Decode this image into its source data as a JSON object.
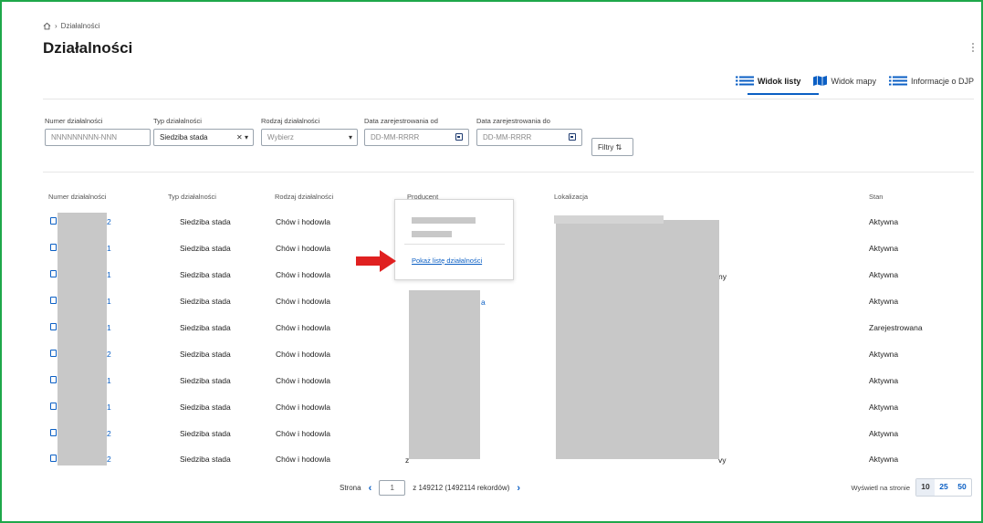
{
  "breadcrumb": {
    "home_icon": "home-icon",
    "current": "Działalności"
  },
  "page": {
    "title": "Działalności"
  },
  "views": [
    {
      "label": "Widok listy",
      "icon": "list-icon",
      "active": true
    },
    {
      "label": "Widok mapy",
      "icon": "map-icon",
      "active": false
    },
    {
      "label": "Informacje o DJP",
      "icon": "list-icon",
      "active": false
    }
  ],
  "filters": {
    "numer": {
      "label": "Numer działalności",
      "placeholder": "NNNNNNNNN-NNN"
    },
    "typ": {
      "label": "Typ działalności",
      "value": "Siedziba stada"
    },
    "rodzaj": {
      "label": "Rodzaj działalności",
      "placeholder": "Wybierz"
    },
    "data_od": {
      "label": "Data zarejestrowania od",
      "placeholder": "DD-MM-RRRR"
    },
    "data_do": {
      "label": "Data zarejestrowania do",
      "placeholder": "DD-MM-RRRR"
    },
    "more_button": "Filtry ⇅"
  },
  "table": {
    "columns": [
      "Numer działalności",
      "Typ działalności",
      "Rodzaj działalności",
      "Producent",
      "Lokalizacja",
      "Stan"
    ],
    "rows": [
      {
        "numer_suffix": "2",
        "typ": "Siedziba stada",
        "rodzaj": "Chów i hodowla",
        "stan": "Aktywna"
      },
      {
        "numer_suffix": "1",
        "typ": "Siedziba stada",
        "rodzaj": "Chów i hodowla",
        "stan": "Aktywna"
      },
      {
        "numer_suffix": "1",
        "typ": "Siedziba stada",
        "rodzaj": "Chów i hodowla",
        "stan": "Aktywna"
      },
      {
        "numer_suffix": "1",
        "typ": "Siedziba stada",
        "rodzaj": "Chów i hodowla",
        "stan": "Aktywna"
      },
      {
        "numer_suffix": "1",
        "typ": "Siedziba stada",
        "rodzaj": "Chów i hodowla",
        "stan": "Zarejestrowana"
      },
      {
        "numer_suffix": "2",
        "typ": "Siedziba stada",
        "rodzaj": "Chów i hodowla",
        "stan": "Aktywna"
      },
      {
        "numer_suffix": "1",
        "typ": "Siedziba stada",
        "rodzaj": "Chów i hodowla",
        "stan": "Aktywna"
      },
      {
        "numer_suffix": "1",
        "typ": "Siedziba stada",
        "rodzaj": "Chów i hodowla",
        "stan": "Aktywna"
      },
      {
        "numer_suffix": "2",
        "typ": "Siedziba stada",
        "rodzaj": "Chów i hodowla",
        "stan": "Aktywna"
      },
      {
        "numer_suffix": "2",
        "typ": "Siedziba stada",
        "rodzaj": "Chów i hodowla",
        "stan": "Aktywna"
      }
    ],
    "fragments": {
      "row1_loc_end": "ny",
      "row4_prod_end": "a",
      "row10_loc_end": "vy",
      "row10_prod_start": "z"
    }
  },
  "popup": {
    "link": "Pokaż listę działalności"
  },
  "pagination": {
    "page_label": "Strona",
    "current_page": "1",
    "total": "z 149212 (1492114 rekordów)"
  },
  "per_page": {
    "label": "Wyświetl na stronie",
    "options": [
      "10",
      "25",
      "50"
    ],
    "selected": "10"
  },
  "colors": {
    "accent": "#0b5fc4",
    "arrow": "#e02020",
    "frame": "#1ea84a"
  }
}
